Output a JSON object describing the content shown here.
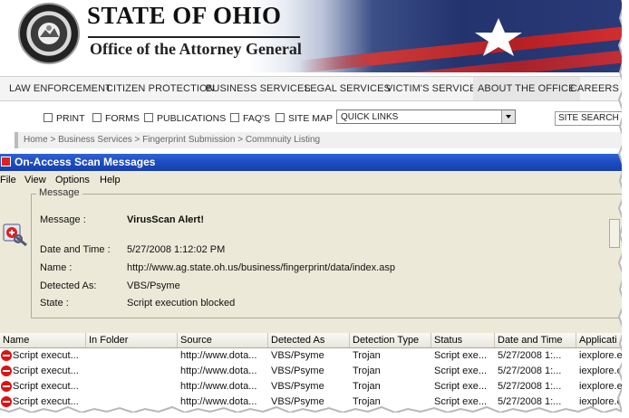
{
  "site": {
    "title": "STATE OF OHIO",
    "subtitle": "Office of the Attorney General",
    "seal_label": "THE ATTORNEY GENERAL",
    "nav": [
      "LAW ENFORCEMENT",
      "CITIZEN PROTECTION",
      "BUSINESS SERVICES",
      "LEGAL SERVICES",
      "VICTIM'S SERVICES",
      "ABOUT THE OFFICE",
      "CAREERS"
    ],
    "tools": [
      "PRINT",
      "FORMS",
      "PUBLICATIONS",
      "FAQ'S",
      "SITE MAP"
    ],
    "quick_links": "QUICK LINKS",
    "site_search": "SITE SEARCH",
    "breadcrumb": "Home > Business Services > Fingerprint Submission > Commnuity Listing"
  },
  "dialog": {
    "title": "On-Access Scan Messages",
    "menu": [
      "File",
      "View",
      "Options",
      "Help"
    ],
    "group_label": "Message",
    "fields": {
      "message_label": "Message :",
      "message_value": "VirusScan Alert!",
      "date_label": "Date and Time :",
      "date_value": "5/27/2008 1:12:02 PM",
      "name_label": "Name :",
      "name_value": "http://www.ag.state.oh.us/business/fingerprint/data/index.asp",
      "detected_label": "Detected As:",
      "detected_value": "VBS/Psyme",
      "state_label": "State :",
      "state_value": "Script execution blocked"
    },
    "table": {
      "columns": [
        "Name",
        "In Folder",
        "Source",
        "Detected As",
        "Detection Type",
        "Status",
        "Date and Time",
        "Applicati"
      ],
      "rows": [
        [
          "Script execut...",
          "",
          "http://www.dota...",
          "VBS/Psyme",
          "Trojan",
          "Script exe...",
          "5/27/2008 1:...",
          "iexplore.e..."
        ],
        [
          "Script execut...",
          "",
          "http://www.dota...",
          "VBS/Psyme",
          "Trojan",
          "Script exe...",
          "5/27/2008 1:...",
          "iexplore.e..."
        ],
        [
          "Script execut...",
          "",
          "http://www.dota...",
          "VBS/Psyme",
          "Trojan",
          "Script exe...",
          "5/27/2008 1:...",
          "iexplore.e..."
        ],
        [
          "Script execut...",
          "",
          "http://www.dota...",
          "VBS/Psyme",
          "Trojan",
          "Script exe...",
          "5/27/2008 1:...",
          "iexplore.e..."
        ]
      ]
    }
  },
  "colors": {
    "titlebar": "#1d4cc2",
    "nav_bg": "#f4f4f4",
    "dialog_bg": "#ece9d8",
    "alert_icon": "#d11"
  }
}
